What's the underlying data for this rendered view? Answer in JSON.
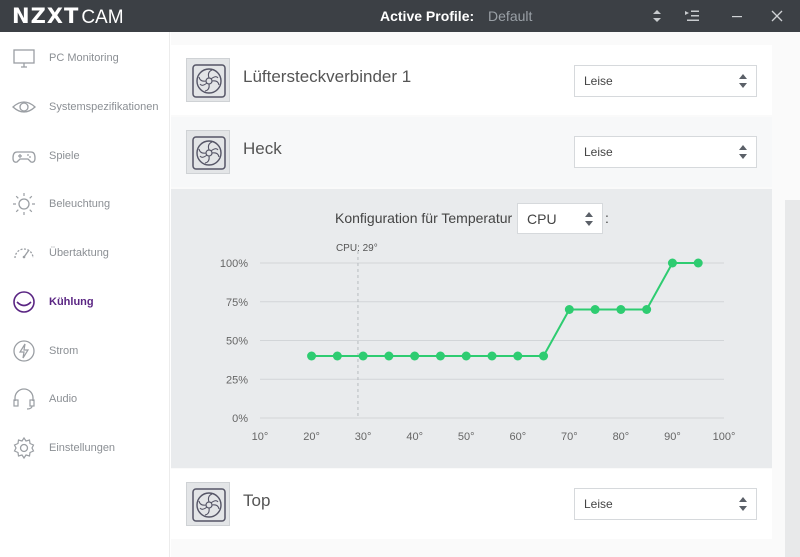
{
  "app": {
    "brand_main": "NZXT",
    "brand_sub": "CAM"
  },
  "header": {
    "profile_label": "Active Profile:",
    "profile_value": "Default"
  },
  "sidebar": {
    "items": [
      {
        "label": "PC Monitoring",
        "icon": "monitor-icon"
      },
      {
        "label": "Systemspezifikationen",
        "icon": "eye-icon"
      },
      {
        "label": "Spiele",
        "icon": "gamepad-icon"
      },
      {
        "label": "Beleuchtung",
        "icon": "sun-icon"
      },
      {
        "label": "Übertaktung",
        "icon": "gauge-icon"
      },
      {
        "label": "Kühlung",
        "icon": "cooling-icon",
        "active": true
      },
      {
        "label": "Strom",
        "icon": "lightning-icon"
      },
      {
        "label": "Audio",
        "icon": "headset-icon"
      },
      {
        "label": "Einstellungen",
        "icon": "gear-icon"
      }
    ]
  },
  "fans": [
    {
      "title": "Lüftersteckverbinder 1",
      "mode": "Leise"
    },
    {
      "title": "Heck",
      "mode": "Leise"
    },
    {
      "title": "Top",
      "mode": "Leise"
    }
  ],
  "config": {
    "label": "Konfiguration für Temperatur",
    "source": "CPU",
    "suffix": ":"
  },
  "colors": {
    "accent": "#5a2583",
    "curve": "#2ecc71",
    "titlebar": "#3c4045"
  },
  "chart_data": {
    "type": "line",
    "x": [
      20,
      25,
      30,
      35,
      40,
      45,
      50,
      55,
      60,
      65,
      70,
      75,
      80,
      85,
      90,
      95
    ],
    "series": [
      {
        "values": [
          40,
          40,
          40,
          40,
          40,
          40,
          40,
          40,
          40,
          40,
          70,
          70,
          70,
          70,
          100,
          100
        ]
      }
    ],
    "xticks": [
      "10°",
      "20°",
      "30°",
      "40°",
      "50°",
      "60°",
      "70°",
      "80°",
      "90°",
      "100°"
    ],
    "xtick_values": [
      10,
      20,
      30,
      40,
      50,
      60,
      70,
      80,
      90,
      100
    ],
    "yticks": [
      "0%",
      "25%",
      "50%",
      "75%",
      "100%"
    ],
    "ytick_values": [
      0,
      25,
      50,
      75,
      100
    ],
    "xlim": [
      10,
      100
    ],
    "ylim": [
      0,
      100
    ],
    "marker": {
      "label": "CPU: 29°",
      "x": 29
    },
    "grid": true
  }
}
